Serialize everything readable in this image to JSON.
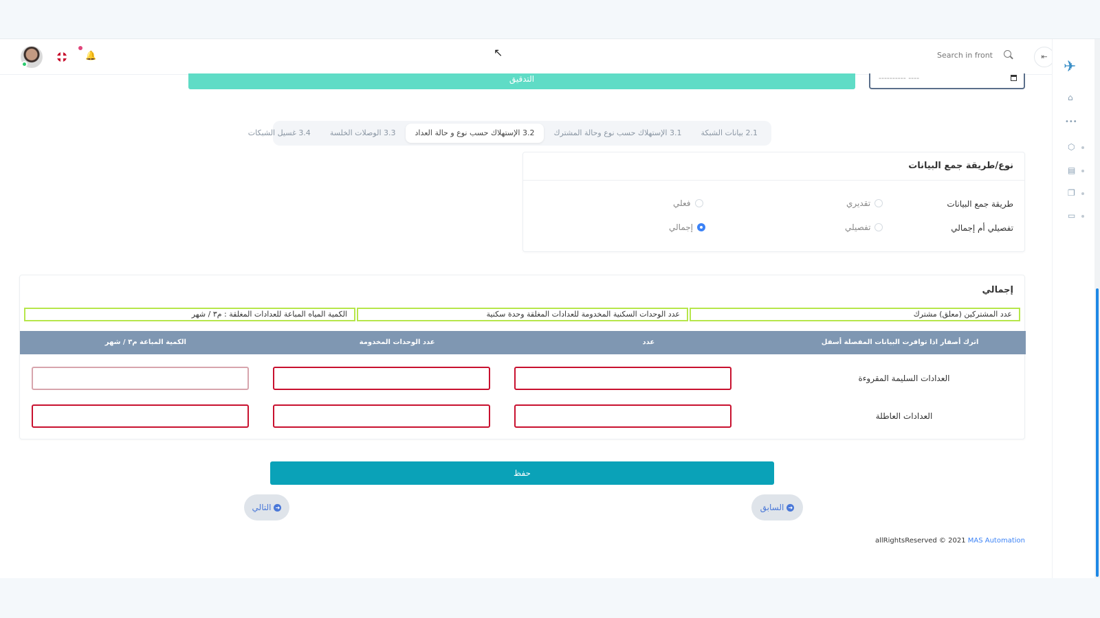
{
  "header": {
    "search_placeholder": "Search in front",
    "collapse_icon": "⇤",
    "bell_icon": "🔔",
    "cursor": "↖"
  },
  "sidebar": {
    "logo": "✈",
    "items": [
      {
        "icon": "⌂"
      },
      {
        "icon": "•••"
      },
      {
        "icon": "⬡"
      },
      {
        "icon": "▤"
      },
      {
        "icon": "❐"
      },
      {
        "icon": "▭"
      }
    ]
  },
  "top": {
    "verify_label": "التدقيق",
    "date_placeholder": "---------- ----"
  },
  "tabs": [
    {
      "label": "2.1 بيانات الشبكة",
      "active": false
    },
    {
      "label": "3.1 الإستهلاك حسب نوع وحالة المشترك",
      "active": false
    },
    {
      "label": "3.2 الإستهلاك حسب نوع و حالة العداد",
      "active": true
    },
    {
      "label": "3.3 الوصلات الخلسة",
      "active": false
    },
    {
      "label": "3.4 غسيل الشبكات",
      "active": false
    }
  ],
  "collection": {
    "title": "نوع/طريقة جمع البيانات",
    "row1": {
      "label": "طريقة جمع البيانات",
      "opt1": "تقديري",
      "opt2": "فعلي"
    },
    "row2": {
      "label": "تفصيلي أم إجمالي",
      "opt1": "تفصيلي",
      "opt2": "إجمالي"
    }
  },
  "summary": {
    "title": "إجمالي",
    "boxes": [
      "عدد المشتركين (معلق)  مشترك",
      "عدد الوحدات السكنية المخدومة للعدادات المغلقة  وحدة سكنية",
      "الكمية المياه المباعة للعدادات المغلقة :  م٣ / شهر"
    ],
    "columns": [
      "اترك أصفار اذا توافرت البيانات المفصلة أسفل",
      "عدد",
      "عدد الوحدات المخدومة",
      "الكمية المباعة م٣ / شهر"
    ],
    "rows": [
      {
        "label": "العدادات السليمة المقروءة"
      },
      {
        "label": "العدادات العاطلة"
      }
    ]
  },
  "actions": {
    "save": "حفظ",
    "previous": "السابق",
    "next": "التالي"
  },
  "footer": {
    "text": "allRightsReserved © 2021",
    "brand": "MAS Automation"
  }
}
